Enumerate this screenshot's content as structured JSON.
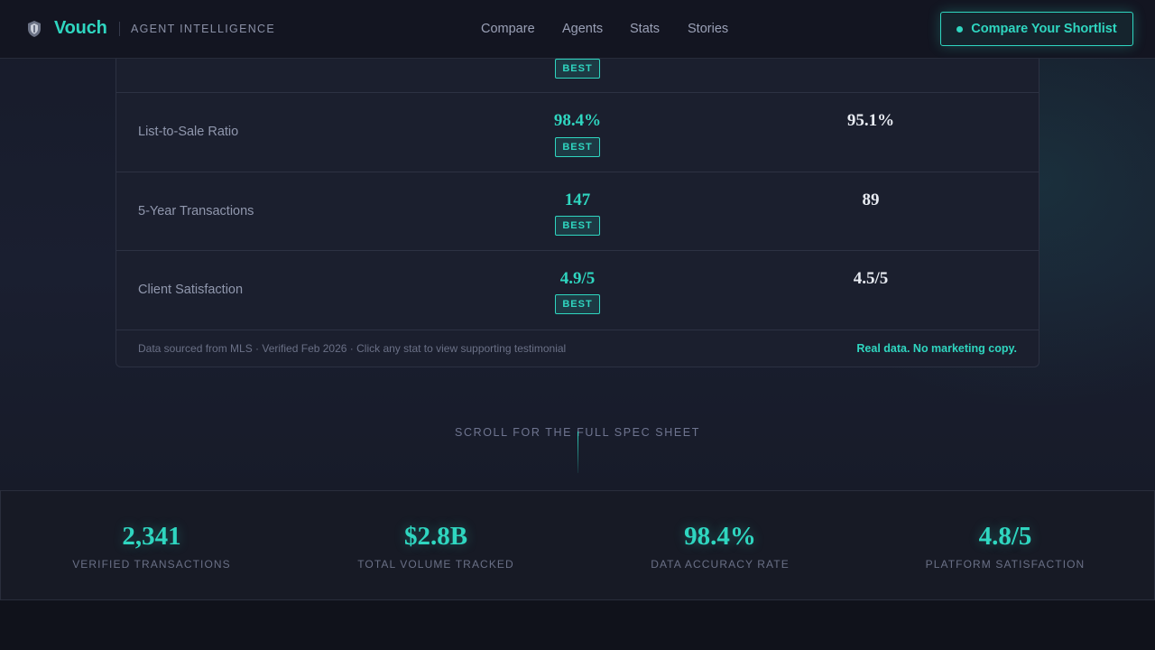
{
  "nav": {
    "brand": "Vouch",
    "tagline": "AGENT INTELLIGENCE",
    "links": [
      "Compare",
      "Agents",
      "Stats",
      "Stories"
    ],
    "cta_label": "Compare Your Shortlist"
  },
  "comparison": {
    "badge_label": "BEST",
    "rows": [
      {
        "label": "",
        "value_a": "",
        "value_b": "",
        "best": true
      },
      {
        "label": "List-to-Sale Ratio",
        "value_a": "98.4%",
        "value_b": "95.1%",
        "best": true
      },
      {
        "label": "5-Year Transactions",
        "value_a": "147",
        "value_b": "89",
        "best": true
      },
      {
        "label": "Client Satisfaction",
        "value_a": "4.9/5",
        "value_b": "4.5/5",
        "best": true
      }
    ],
    "footer_note": "Data sourced from MLS · Verified Feb 2026 · Click any stat to view supporting testimonial",
    "footer_claim": "Real data. No marketing copy."
  },
  "scroll_hint": "SCROLL FOR THE FULL SPEC SHEET",
  "stats": [
    {
      "value": "2,341",
      "label": "VERIFIED TRANSACTIONS"
    },
    {
      "value": "$2.8B",
      "label": "TOTAL VOLUME TRACKED"
    },
    {
      "value": "98.4%",
      "label": "DATA ACCURACY RATE"
    },
    {
      "value": "4.8/5",
      "label": "PLATFORM SATISFACTION"
    }
  ],
  "colors": {
    "accent": "#2fd6c0",
    "background": "#171b2a"
  }
}
